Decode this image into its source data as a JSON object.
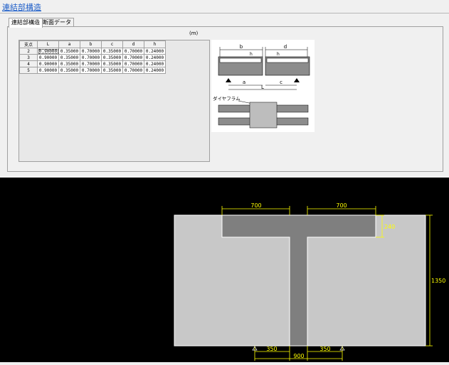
{
  "window": {
    "title": "連結部構造"
  },
  "tabs": [
    {
      "label": "連結部構造",
      "active": true
    },
    {
      "label": "断面データ",
      "active": false
    }
  ],
  "unit_label": "(m)",
  "table": {
    "headers": [
      "支点",
      "L",
      "a",
      "b",
      "c",
      "d",
      "h"
    ],
    "rows": [
      [
        "2",
        "0.90000",
        "0.35000",
        "0.70000",
        "0.35000",
        "0.70000",
        "0.24000"
      ],
      [
        "3",
        "0.90000",
        "0.35000",
        "0.70000",
        "0.35000",
        "0.70000",
        "0.24000"
      ],
      [
        "4",
        "0.90000",
        "0.35000",
        "0.70000",
        "0.35000",
        "0.70000",
        "0.24000"
      ],
      [
        "5",
        "0.90000",
        "0.35000",
        "0.70000",
        "0.35000",
        "0.70000",
        "0.24000"
      ]
    ]
  },
  "schematic": {
    "labels": {
      "b": "b",
      "d": "d",
      "h1": "h",
      "h2": "h",
      "a": "a",
      "c": "c",
      "L": "L",
      "diaphragm": "ダイヤフラム"
    }
  },
  "section_view": {
    "dims": {
      "left_top": "700",
      "right_top": "700",
      "flange": "240",
      "height": "1350",
      "bottom_left": "350",
      "bottom_right": "350",
      "bottom_total": "900"
    },
    "colors": {
      "background": "#000000",
      "outer": "#c8c8c8",
      "section": "#7f7f7f",
      "dim": "#ffff00",
      "outline": "#ffffff"
    }
  }
}
